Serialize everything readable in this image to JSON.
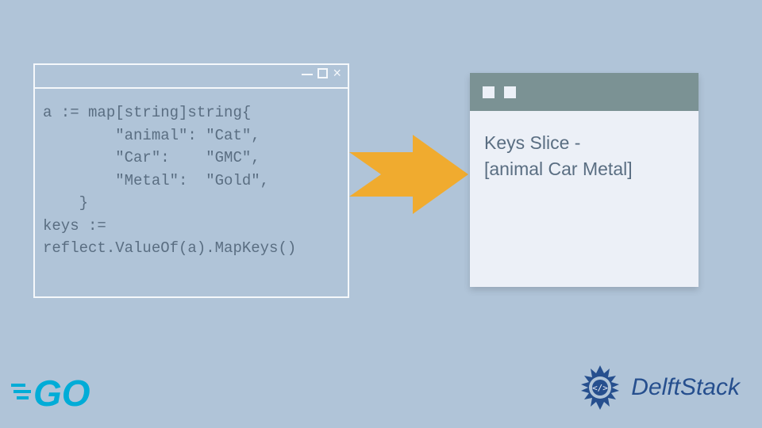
{
  "code_window": {
    "lines": "a := map[string]string{\n        \"animal\": \"Cat\",\n        \"Car\":    \"GMC\",\n        \"Metal\":  \"Gold\",\n    }\nkeys :=\nreflect.ValueOf(a).MapKeys()"
  },
  "output_window": {
    "line1": "Keys Slice -",
    "line2": "[animal Car Metal]"
  },
  "logos": {
    "go": "GO",
    "delft": "DelftStack"
  },
  "colors": {
    "bg": "#b0c4d8",
    "arrow": "#f0ab2f",
    "panel": "#ecf0f7",
    "panelHeader": "#7b9294",
    "textMuted": "#5a6e82",
    "delftBlue": "#264f8e",
    "goBlue": "#00acd7"
  }
}
